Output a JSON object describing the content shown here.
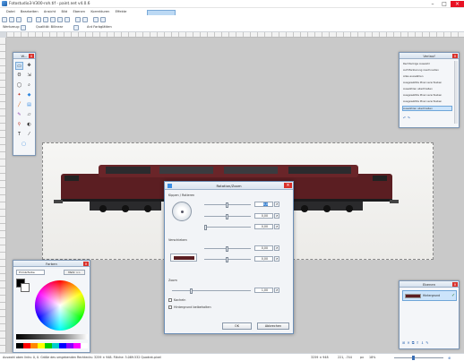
{
  "window": {
    "title": "Fotostudio3-V300-roh.tif - paint.net v4.0.6"
  },
  "menu": [
    "Datei",
    "Bearbeiten",
    "Ansicht",
    "Bild",
    "Ebenen",
    "Korrekturen",
    "Effekte"
  ],
  "toolbar": {
    "mode_label": "Werkzeug:",
    "quality_label": "Qualität: Bilinear",
    "antialias_label": "Ant Farbglätten"
  },
  "tools_palette": {
    "title": "W..."
  },
  "history": {
    "title": "Verlauf",
    "items": [
      "Rechteckige Auswahl",
      "Auf Markierung zuschneiden",
      "Alles auswählen",
      "Ausgewählte Pixel verschieben",
      "Auswählen abschließen",
      "Ausgewählte Pixel verschieben",
      "Ausgewählte Pixel verschieben",
      "Auswählen abschließen"
    ],
    "selected_index": 7
  },
  "layers": {
    "title": "Ebenen",
    "layer_name": "Hintergrund"
  },
  "colors": {
    "title": "Farben",
    "primary_label": "Primärfarbe",
    "more_label": "Mehr >>"
  },
  "dialog": {
    "title": "Rotation/Zoom",
    "section_rotate": "Kippen / Rotieren",
    "angle_value": "0,0",
    "tilt_value": "0,00",
    "tilt2_value": "0,00",
    "section_pan": "Verschieben",
    "pan_x": "0,00",
    "pan_y": "0,00",
    "section_zoom": "Zoom",
    "zoom_value": "1,00",
    "tile_label": "Kacheln",
    "keep_bg_label": "Hintergrund beibehalten",
    "ok": "OK",
    "cancel": "Abbrechen"
  },
  "status": {
    "hint": "Auswahl oben links: 0, 0. Größe des umgebenden Rechtecks: 3259 × 948. Fläche: 3.089.532 Quadrat-pixel",
    "size": "3259 × 948",
    "pos": "221, -744",
    "unit": "px",
    "zoom": "18%"
  },
  "colors_accent": {
    "title_close": "#d9302a",
    "selection": "#3b84d4",
    "loco_body": "#5b1e22"
  }
}
